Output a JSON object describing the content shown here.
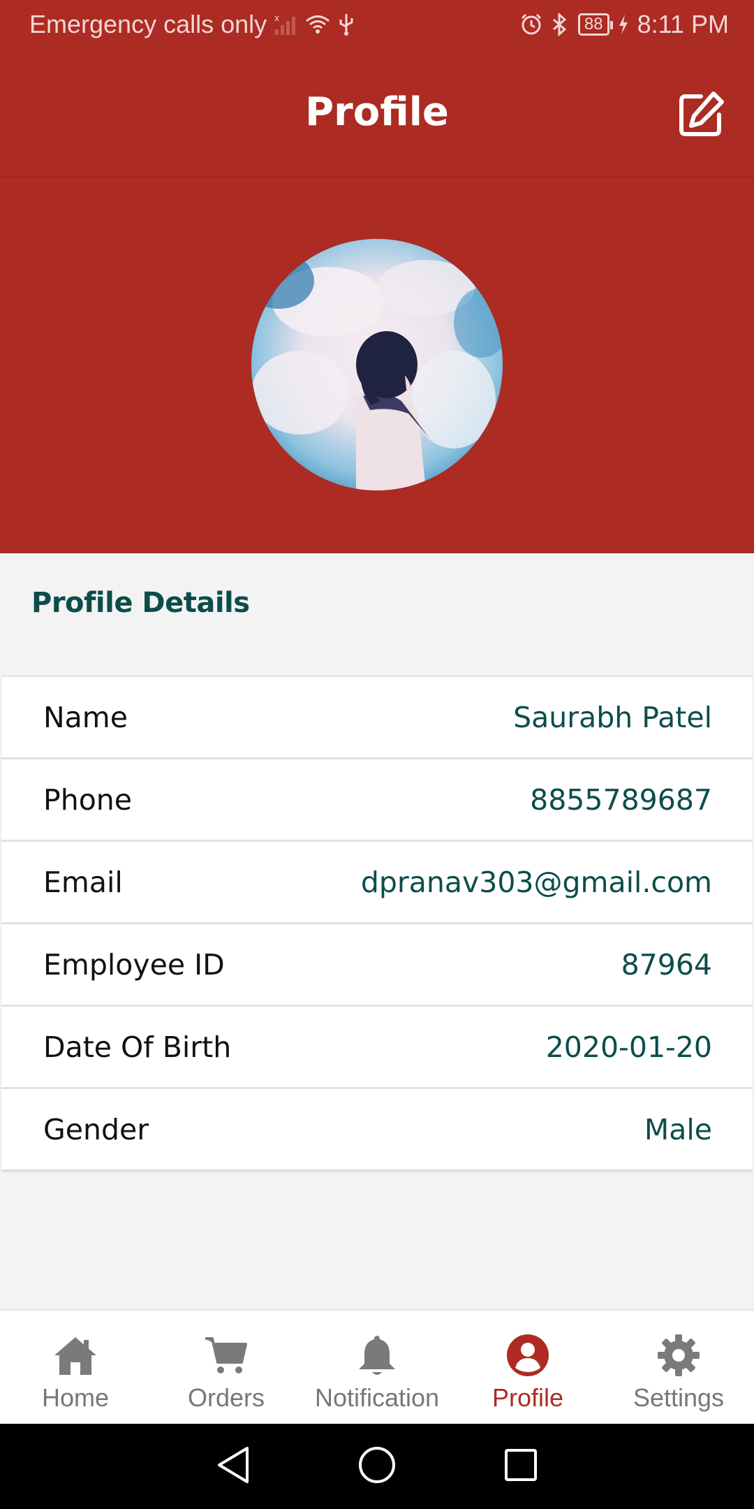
{
  "status_bar": {
    "carrier": "Emergency calls only",
    "battery": "88",
    "time": "8:11 PM"
  },
  "app_bar": {
    "title": "Profile",
    "edit_icon": "edit-icon"
  },
  "profile_header": {
    "avatar": "avatar-image"
  },
  "details": {
    "section_title": "Profile Details",
    "rows": [
      {
        "label": "Name",
        "value": "Saurabh Patel"
      },
      {
        "label": "Phone",
        "value": "8855789687"
      },
      {
        "label": "Email",
        "value": "dpranav303@gmail.com"
      },
      {
        "label": "Employee ID",
        "value": "87964"
      },
      {
        "label": "Date Of Birth",
        "value": "2020-01-20"
      },
      {
        "label": "Gender",
        "value": "Male"
      }
    ]
  },
  "bottom_nav": {
    "items": [
      {
        "label": "Home",
        "icon": "home-icon",
        "active": false
      },
      {
        "label": "Orders",
        "icon": "cart-icon",
        "active": false
      },
      {
        "label": "Notification",
        "icon": "bell-icon",
        "active": false
      },
      {
        "label": "Profile",
        "icon": "user-circle-icon",
        "active": true
      },
      {
        "label": "Settings",
        "icon": "gear-icon",
        "active": false
      }
    ]
  },
  "colors": {
    "primary": "#ac2b23",
    "accent_text": "#0c4d4b",
    "background": "#f3f3f3",
    "inactive_nav": "#777777"
  },
  "system_nav": {
    "back_icon": "back-icon",
    "home_icon": "home-circle-icon",
    "recents_icon": "recents-icon"
  }
}
